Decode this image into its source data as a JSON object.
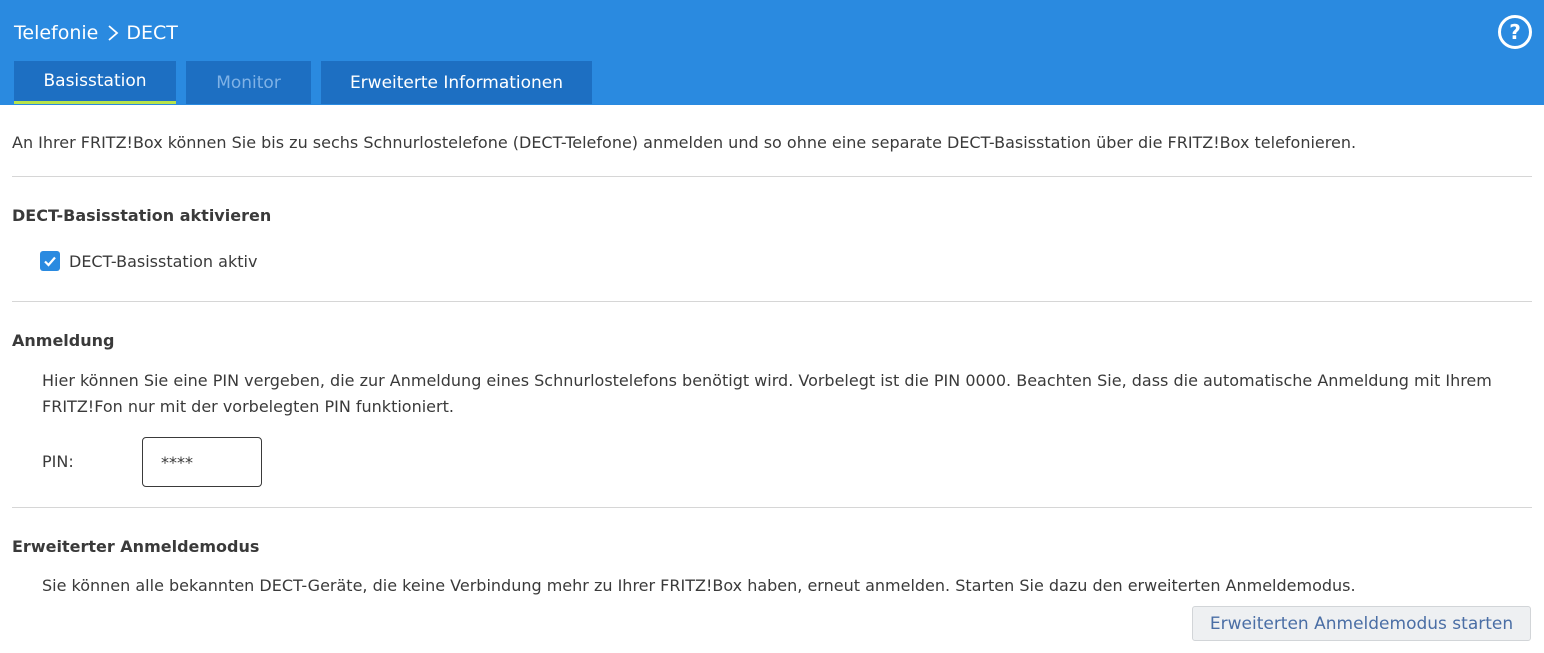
{
  "header": {
    "breadcrumb": [
      "Telefonie",
      "DECT"
    ],
    "help_label": "?"
  },
  "tabs": [
    {
      "label": "Basisstation",
      "active": true
    },
    {
      "label": "Monitor",
      "active": false
    },
    {
      "label": "Erweiterte Informationen",
      "active": false
    }
  ],
  "intro_text": "An Ihrer FRITZ!Box können Sie bis zu sechs Schnurlostelefone (DECT-Telefone) anmelden und so ohne eine separate DECT-Basisstation über die FRITZ!Box telefonieren.",
  "sections": {
    "activate": {
      "title": "DECT-Basisstation aktivieren",
      "checkbox_label": "DECT-Basisstation aktiv",
      "checked": true
    },
    "registration": {
      "title": "Anmeldung",
      "description": "Hier können Sie eine PIN vergeben, die zur Anmeldung eines Schnurlostelefons benötigt wird. Vorbelegt ist die PIN 0000. Beachten Sie, dass die automatische Anmeldung mit Ihrem FRITZ!Fon nur mit der vorbelegten PIN funktioniert.",
      "pin_label": "PIN:",
      "pin_value": "****"
    },
    "extended": {
      "title": "Erweiterter Anmeldemodus",
      "description": "Sie können alle bekannten DECT-Geräte, die keine Verbindung mehr zu Ihrer FRITZ!Box haben, erneut anmelden. Starten Sie dazu den erweiterten Anmeldemodus.",
      "button_label": "Erweiterten Anmeldemodus starten"
    }
  },
  "colors": {
    "header_bg": "#2a8ae0",
    "tab_bg": "#1d6fc2",
    "tab_active_underline": "#b8e34a",
    "checkbox": "#2a8ae0"
  }
}
